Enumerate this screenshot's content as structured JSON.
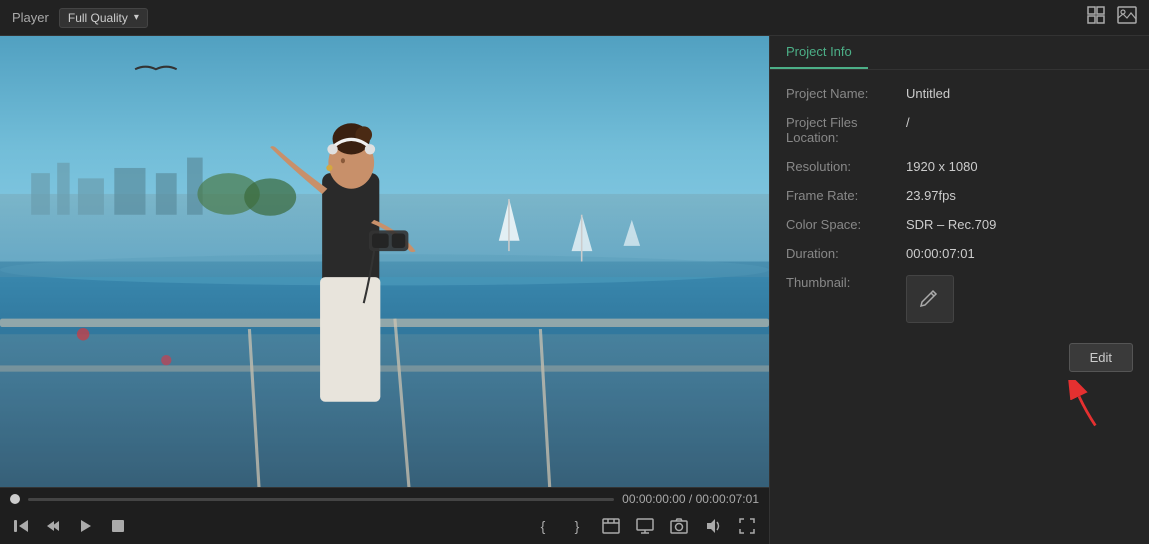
{
  "topbar": {
    "player_label": "Player",
    "quality_label": "Full Quality",
    "chevron": "▾"
  },
  "project_info": {
    "tab_label": "Project Info",
    "fields": [
      {
        "label": "Project Name:",
        "value": "Untitled"
      },
      {
        "label": "Project Files\nLocation:",
        "value": "/"
      },
      {
        "label": "Resolution:",
        "value": "1920 x 1080"
      },
      {
        "label": "Frame Rate:",
        "value": "23.97fps"
      },
      {
        "label": "Color Space:",
        "value": "SDR – Rec.709"
      },
      {
        "label": "Duration:",
        "value": "00:00:07:01"
      },
      {
        "label": "Thumbnail:",
        "value": ""
      }
    ],
    "edit_button": "Edit"
  },
  "controls": {
    "time_current": "00:00:00:00",
    "time_separator": "/",
    "time_total": "00:00:07:01",
    "icons": {
      "skip_back": "⏮",
      "step_back": "⏪",
      "play": "▶",
      "stop": "■",
      "brace_open": "{",
      "brace_close": "}",
      "mark_in": "⬛",
      "screen": "🖥",
      "camera": "📷",
      "audio": "🔊",
      "expand": "⛶"
    }
  },
  "colors": {
    "accent": "#4caf87",
    "bg_dark": "#1a1a1a",
    "bg_medium": "#252525",
    "sidebar_border": "#333",
    "text_primary": "#ccc",
    "text_muted": "#888"
  }
}
